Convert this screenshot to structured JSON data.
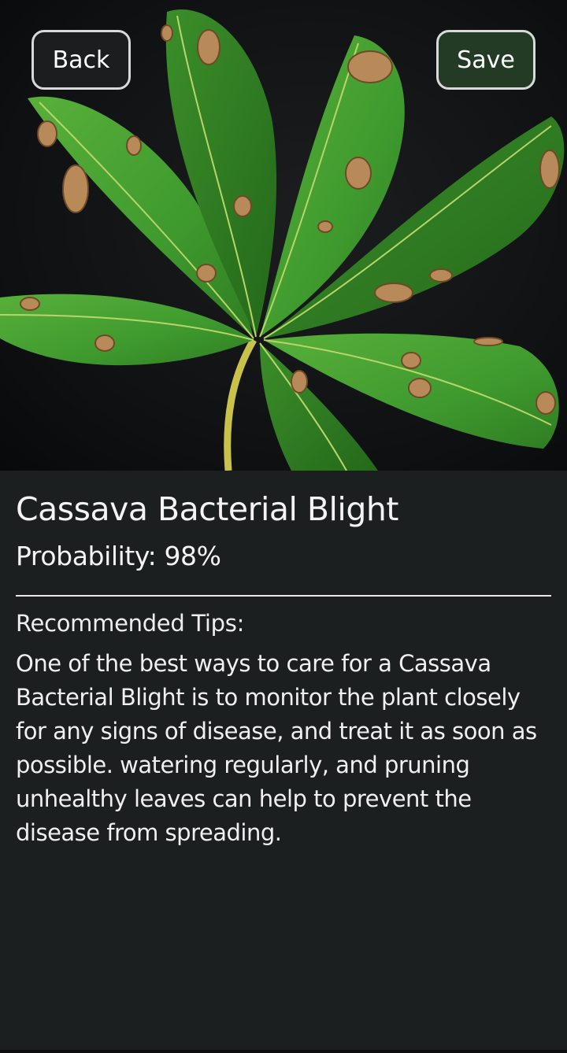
{
  "header": {
    "back_label": "Back",
    "save_label": "Save"
  },
  "result": {
    "disease_name": "Cassava Bacterial Blight",
    "probability_text": "Probability: 98%"
  },
  "tips": {
    "heading": "Recommended Tips:",
    "body": "One of the best ways to care for a Cassava Bacterial Blight is to monitor the plant closely for any signs of disease, and treat it as soon as possible. watering regularly, and pruning unhealthy leaves can help to prevent the disease from spreading."
  },
  "colors": {
    "background": "#1c1f20",
    "save_button": "#233a25",
    "back_button": "#1c1e20",
    "leaf_green": "#3f9a2e",
    "lesion_brown": "#b88a5a"
  }
}
